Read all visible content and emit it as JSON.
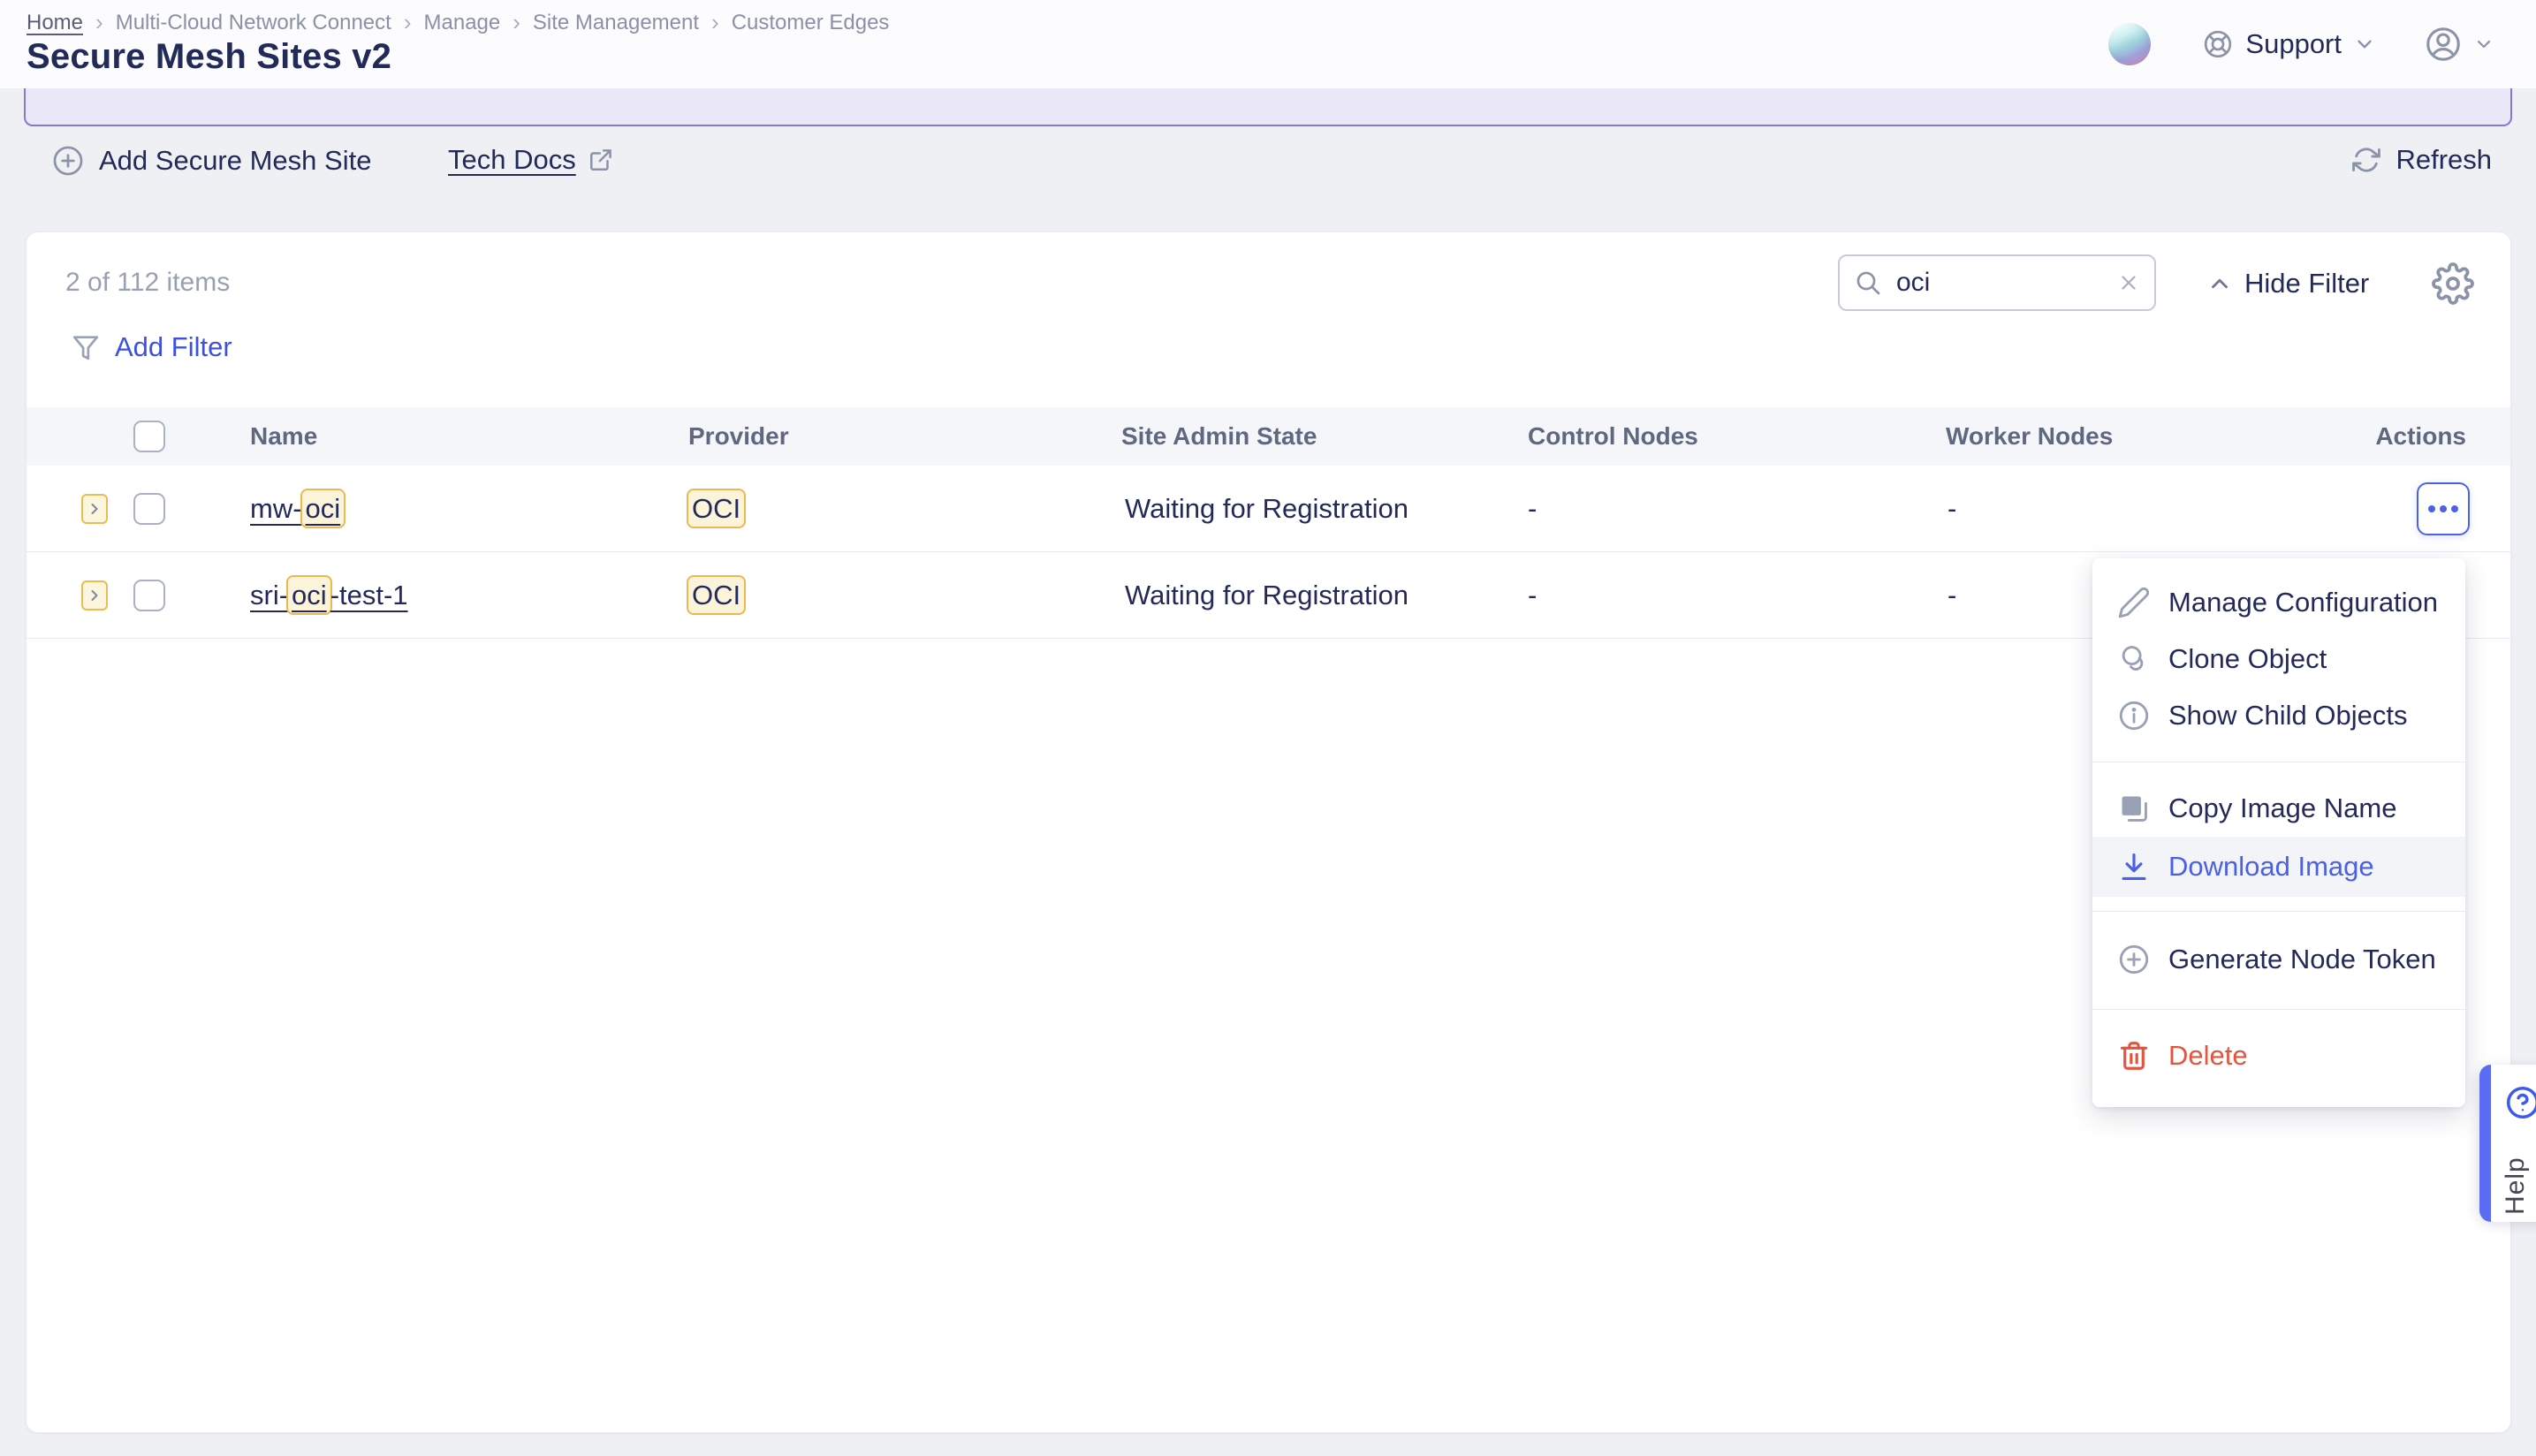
{
  "page": {
    "title": "Secure Mesh Sites v2"
  },
  "breadcrumbs": {
    "separator": "›",
    "items": [
      "Home",
      "Multi-Cloud Network Connect",
      "Manage",
      "Site Management",
      "Customer Edges"
    ]
  },
  "topbar": {
    "support_label": "Support"
  },
  "toolbar": {
    "add_site": "Add Secure Mesh Site",
    "tech_docs": "Tech Docs",
    "refresh": "Refresh"
  },
  "filters": {
    "items_count": "2 of 112 items",
    "add_filter": "Add Filter",
    "search_value": "oci",
    "hide_filter": "Hide Filter"
  },
  "table": {
    "headers": {
      "name": "Name",
      "provider": "Provider",
      "site_admin_state": "Site Admin State",
      "control_nodes": "Control Nodes",
      "worker_nodes": "Worker Nodes",
      "actions": "Actions"
    },
    "rows": [
      {
        "name_pre": "mw-",
        "name_match": "oci",
        "name_post": "",
        "provider_match": "OCI",
        "site_admin_state": "Waiting for Registration",
        "control_nodes": "-",
        "worker_nodes": "-"
      },
      {
        "name_pre": "sri-",
        "name_match": "oci",
        "name_post": "-test-1",
        "provider_match": "OCI",
        "site_admin_state": "Waiting for Registration",
        "control_nodes": "-",
        "worker_nodes": "-"
      }
    ]
  },
  "actions_menu": {
    "manage_configuration": "Manage Configuration",
    "clone_object": "Clone Object",
    "show_child_objects": "Show Child Objects",
    "copy_image_name": "Copy Image Name",
    "download_image": "Download Image",
    "generate_node_token": "Generate Node Token",
    "delete": "Delete"
  },
  "help": {
    "label": "Help"
  },
  "colors": {
    "accent_blue": "#4d61e6",
    "link_blue": "#3c51e0",
    "delete_red": "#e4543e",
    "highlight_bg": "#fcf4da",
    "highlight_border": "#edb94c",
    "banner_purple": "#8677d9",
    "navy_text": "#232a5a"
  }
}
